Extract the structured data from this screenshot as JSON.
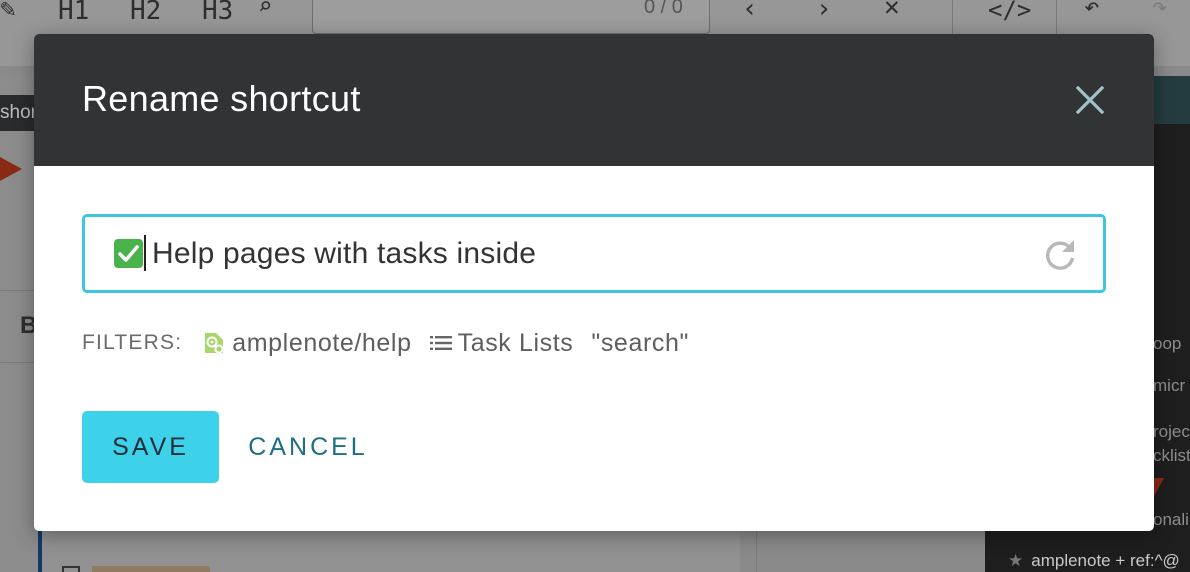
{
  "background": {
    "toolbar": {
      "h1": "H1",
      "h2": "H2",
      "h3": "H3",
      "find_count": "0 / 0"
    },
    "left_tab_text": "shor",
    "bold_letter": "B",
    "right_items": [
      "oop",
      "micr",
      "rojec",
      "cklist",
      "onali"
    ],
    "bottom_item": "amplenote + ref:^@"
  },
  "modal": {
    "title": "Rename shortcut",
    "name_value": "Help pages with tasks inside",
    "filters_label": "FILTERS:",
    "filters": [
      {
        "icon": "tag-icon",
        "label": "amplenote/help"
      },
      {
        "icon": "list-icon",
        "label": "Task Lists"
      },
      {
        "icon": "",
        "label": "\"search\""
      }
    ],
    "save_label": "SAVE",
    "cancel_label": "CANCEL",
    "colors": {
      "header": "#323335",
      "accent": "#3dc6e0",
      "save_button": "#3dd2ea",
      "cancel_text": "#1e6f80",
      "emoji_green": "#4ab24a"
    }
  }
}
